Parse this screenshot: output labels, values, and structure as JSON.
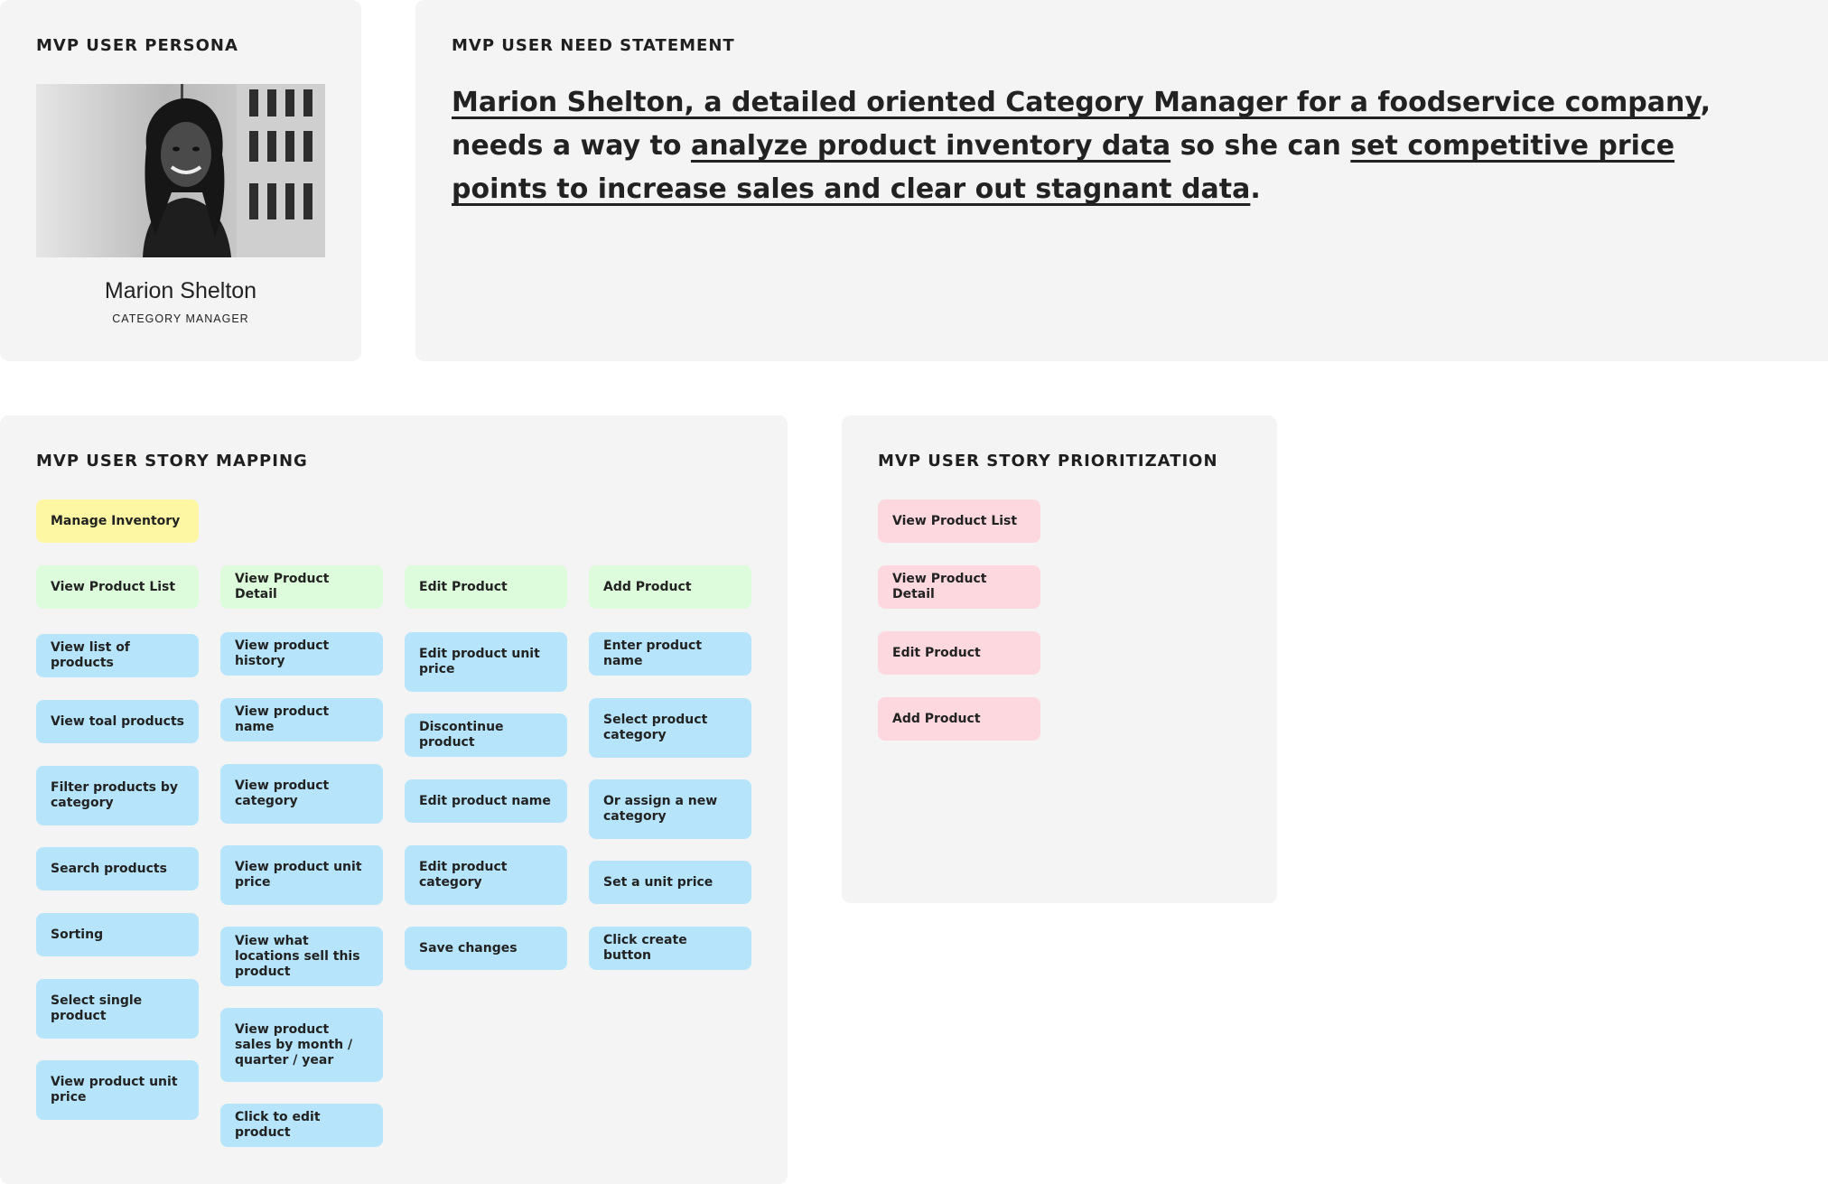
{
  "persona": {
    "title": "MVP USER PERSONA",
    "name": "Marion Shelton",
    "role": "CATEGORY MANAGER"
  },
  "need": {
    "title": "MVP USER NEED STATEMENT",
    "p1": "Marion Shelton, a detailed oriented Category Manager for a foodservice company",
    "p2": ",  needs a way to ",
    "p3": "analyze product inventory data",
    "p4": " so she can ",
    "p5": "set competitive price points to increase sales and clear out stagnant data",
    "p6": "."
  },
  "mapping": {
    "title": "MVP USER STORY MAPPING",
    "epic": "Manage Inventory",
    "columns": [
      {
        "header": "View Product List",
        "items": [
          "View list of products",
          "View toal products",
          "Filter products by category",
          "Search products",
          "Sorting",
          "Select single product",
          "View product unit price"
        ]
      },
      {
        "header": "View Product Detail",
        "items": [
          "View product history",
          "View product name",
          "View product category",
          "View product unit price",
          "View what locations sell this product",
          "View product sales by month / quarter / year",
          "Click to edit product"
        ]
      },
      {
        "header": "Edit Product",
        "items": [
          "Edit product unit price",
          "Discontinue product",
          "Edit product name",
          "Edit product category",
          "Save changes"
        ]
      },
      {
        "header": "Add Product",
        "items": [
          "Enter product name",
          "Select product category",
          "Or assign a new category",
          "Set a unit price",
          "Click create button"
        ]
      }
    ]
  },
  "prioritization": {
    "title": "MVP USER STORY PRIORITIZATION",
    "items": [
      "View Product List",
      "View Product Detail",
      "Edit Product",
      "Add Product"
    ]
  },
  "colors": {
    "panel": "#f4f4f4",
    "epic": "#fdf7a3",
    "activity": "#dcfcdc",
    "story": "#b6e5fb",
    "priority": "#fdd9df"
  },
  "icons": [
    "persona-photo"
  ]
}
